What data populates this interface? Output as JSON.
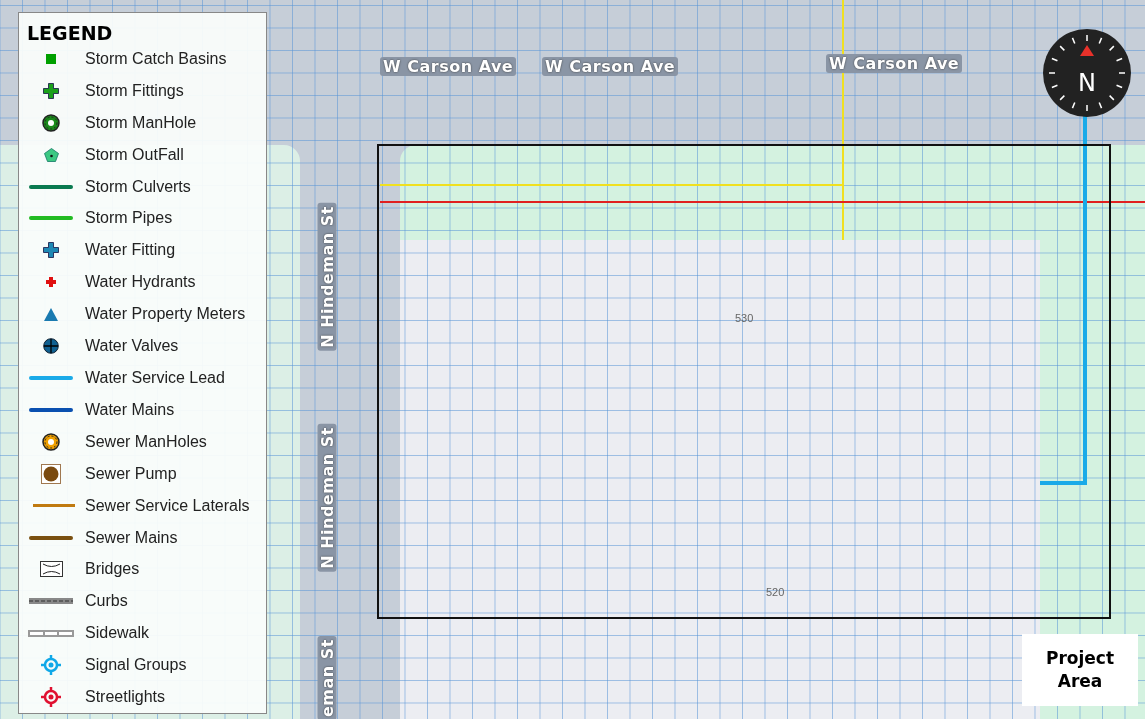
{
  "legend": {
    "title": "LEGEND",
    "items": [
      {
        "label": "Storm Catch Basins",
        "kind": "square",
        "color": "#00a000"
      },
      {
        "label": "Storm Fittings",
        "kind": "cross",
        "color": "#1aa01a"
      },
      {
        "label": "Storm ManHole",
        "kind": "manhole",
        "color": "#1a8a1a"
      },
      {
        "label": "Storm OutFall",
        "kind": "pentagon",
        "color": "#3cc882"
      },
      {
        "label": "Storm Culverts",
        "kind": "line",
        "color": "#0a7a50"
      },
      {
        "label": "Storm Pipes",
        "kind": "line",
        "color": "#22bb22"
      },
      {
        "label": "Water Fitting",
        "kind": "cross",
        "color": "#1e88b4"
      },
      {
        "label": "Water Hydrants",
        "kind": "hydrant",
        "color": "#e01010"
      },
      {
        "label": "Water Property Meters",
        "kind": "triangle",
        "color": "#1a7ab0"
      },
      {
        "label": "Water Valves",
        "kind": "valve",
        "color": "#106090"
      },
      {
        "label": "Water Service Lead",
        "kind": "line",
        "color": "#1aaae8"
      },
      {
        "label": "Water Mains",
        "kind": "line",
        "color": "#0a50b0"
      },
      {
        "label": "Sewer ManHoles",
        "kind": "manhole",
        "color": "#f0a000"
      },
      {
        "label": "Sewer Pump",
        "kind": "pump",
        "color": "#7a4a10"
      },
      {
        "label": "Sewer Service Laterals",
        "kind": "thinline",
        "color": "#c07a10"
      },
      {
        "label": "Sewer Mains",
        "kind": "line",
        "color": "#7a5010"
      },
      {
        "label": "Bridges",
        "kind": "bridge",
        "color": "#333333"
      },
      {
        "label": "Curbs",
        "kind": "curb",
        "color": "#888888"
      },
      {
        "label": "Sidewalk",
        "kind": "sidewalk",
        "color": "#999999"
      },
      {
        "label": "Signal Groups",
        "kind": "target",
        "color": "#10a8e8"
      },
      {
        "label": "Streetlights",
        "kind": "target",
        "color": "#e01030"
      }
    ]
  },
  "street_labels": [
    "W Carson Ave",
    "W Carson Ave",
    "W Carson Ave",
    "N Hindeman St",
    "N Hindeman St",
    "eman St"
  ],
  "parcel_labels": [
    "530",
    "520"
  ],
  "compass": {
    "label": "N"
  },
  "project_area_label": "Project Area"
}
